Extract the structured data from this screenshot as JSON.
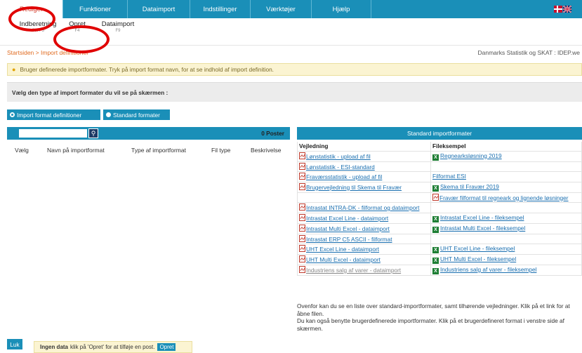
{
  "menu": {
    "items": [
      "Rediger",
      "Funktioner",
      "Dataimport",
      "Indstillinger",
      "Værktøjer",
      "Hjælp"
    ],
    "active_index": 0
  },
  "submenu": [
    {
      "label": "Indberetning",
      "shortcut": "Ctrl F5"
    },
    {
      "label": "Opret",
      "shortcut": "F4"
    },
    {
      "label": "Dataimport",
      "shortcut": "F9"
    }
  ],
  "breadcrumb": {
    "home": "Startsiden",
    "current": "Import definitioner"
  },
  "owner": "Danmarks Statistik og SKAT : IDEP.we",
  "info": "Bruger definerede importformater. Tryk på import format navn, for at se indhold af import definition.",
  "select_prompt": "Vælg den type af import formater du vil se på skærmen :",
  "toggles": {
    "user_defined": "Import format definitioner",
    "standard": "Standard formater"
  },
  "left_panel": {
    "search_placeholder": "",
    "post_count": "0 Poster",
    "columns": [
      "Vælg",
      "Navn på importformat",
      "Type af importformat",
      "Fil type",
      "Beskrivelse"
    ]
  },
  "right_panel": {
    "title": "Standard importformater",
    "col_guide": "Vejledning",
    "col_example": "Fileksempel",
    "rows": [
      {
        "guide": "Lønstatistik - upload af fil",
        "example": "Regnearksløsning 2019",
        "ex_icon": "xls"
      },
      {
        "guide": "Lønstatistik - ESI-standard",
        "example": "",
        "ex_icon": ""
      },
      {
        "guide": "Fraværsstatistik - upload af fil",
        "example": "Filformat ESI",
        "ex_icon": ""
      },
      {
        "guide": "Brugervejledning til Skema til Fravær",
        "example": "Skema til Fravær 2019",
        "ex_icon": "xls"
      },
      {
        "guide": "",
        "example": "Fravær filformat til regneark og lignende løsninger",
        "ex_icon": "pdf"
      },
      {
        "guide": "Intrastat INTRA-DK - filformat og dataimport",
        "example": "",
        "ex_icon": ""
      },
      {
        "guide": "Intrastat Excel Line - dataimport",
        "example": "Intrastat Excel Line - fileksempel",
        "ex_icon": "xls"
      },
      {
        "guide": "Intrastat Multi Excel - dataimport",
        "example": "Intrastat Multi Excel - fileksempel",
        "ex_icon": "xls"
      },
      {
        "guide": "Intrastat ERP C5 ASCII - filformat",
        "example": "",
        "ex_icon": ""
      },
      {
        "guide": "UHT Excel Line - dataimport",
        "example": "UHT Excel Line - fileksempel",
        "ex_icon": "xls"
      },
      {
        "guide": "UHT Multi Excel - dataimport",
        "example": "UHT Multi Excel - fileksempel",
        "ex_icon": "xls"
      },
      {
        "guide": "Industriens salg af varer - dataimport",
        "example": "Industriens salg af varer - fileksempel",
        "ex_icon": "xls"
      }
    ],
    "footer_1": "Ovenfor kan du se en liste over standard-importformater, samt tilhørende vejledninger. Klik på et link for at åbne filen.",
    "footer_2": "Du kan også benytte brugerdefinerede importformater. Klik på et brugerdefineret format i venstre side af skærmen."
  },
  "close_button": "Luk",
  "nodata": {
    "bold": "Ingen data",
    "text": "klik på 'Opret' for at tilføje en post.",
    "button": "Opret"
  },
  "colors": {
    "primary": "#1a8fb8",
    "accent": "#e06b20",
    "annotation": "#e00000"
  }
}
